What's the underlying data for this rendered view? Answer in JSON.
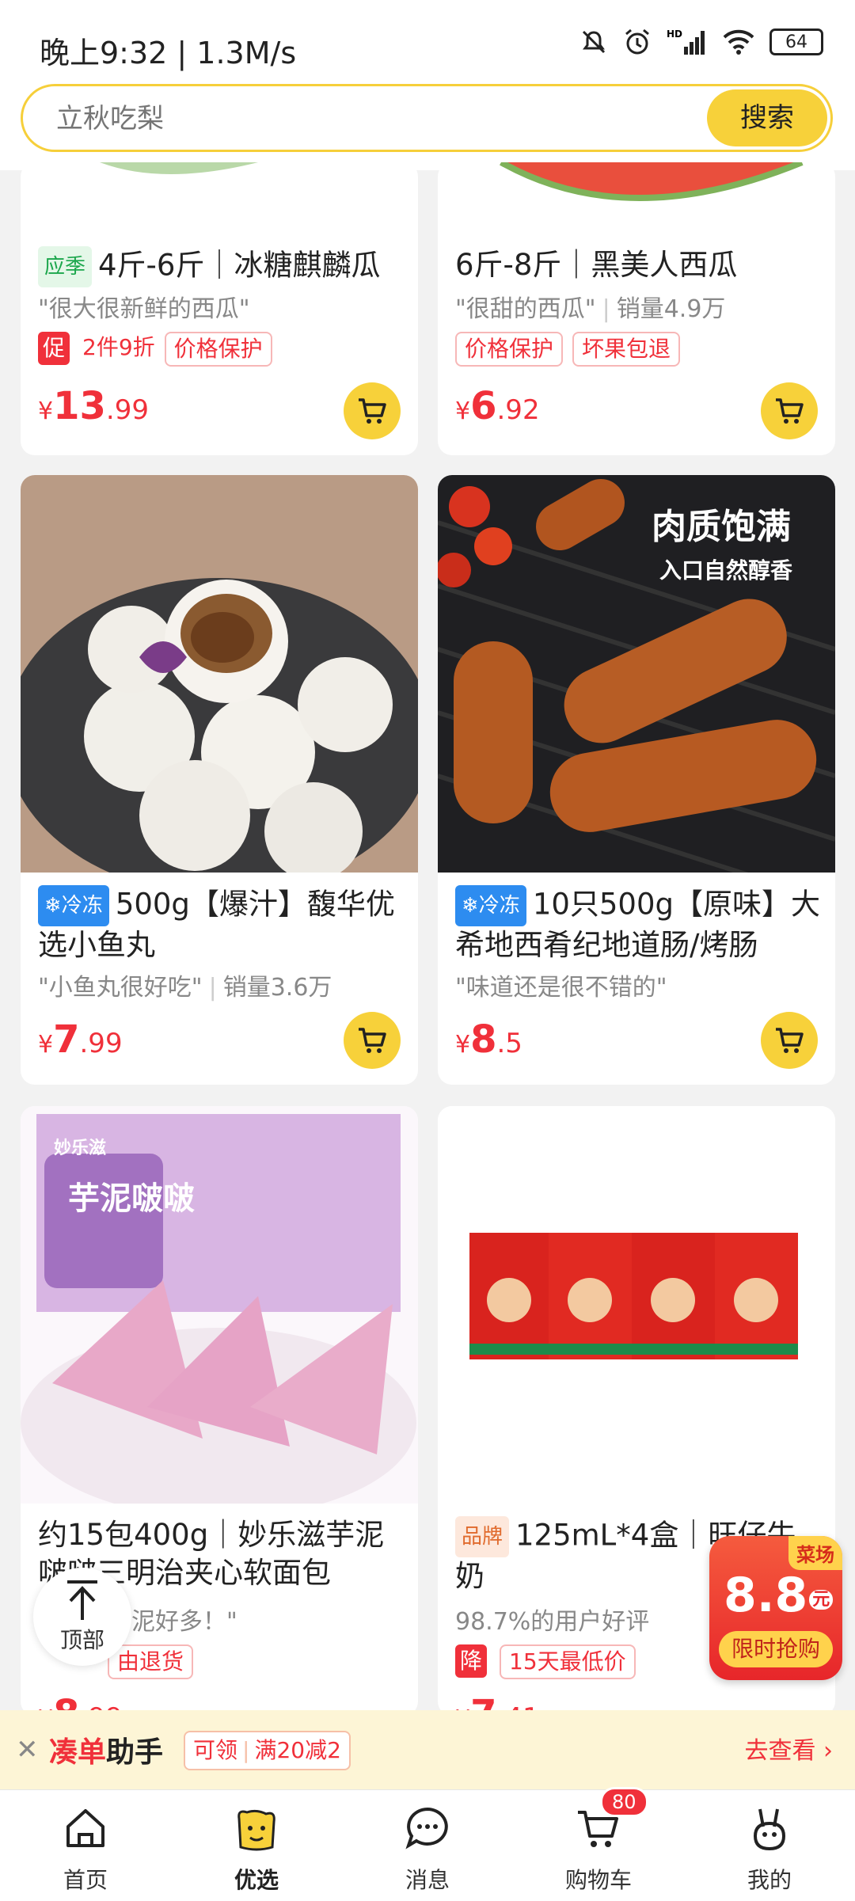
{
  "status_bar": {
    "time": "晚上9:32 | 1.3M/s",
    "battery": "64",
    "icons": [
      "bell-off-icon",
      "alarm-icon",
      "signal-icon",
      "wifi-icon",
      "battery-icon"
    ]
  },
  "search": {
    "placeholder": "立秋吃梨",
    "button": "搜索"
  },
  "products": [
    {
      "tag": "应季",
      "title": "4斤-6斤｜冰糖麒麟瓜",
      "quote": "\"很大很新鲜的西瓜\"",
      "sales": "",
      "promo_badge": "促",
      "promos": [
        "2件9折",
        "价格保护"
      ],
      "price_int": "13",
      "price_dec": ".99",
      "yen": "¥"
    },
    {
      "tag": "",
      "title": "6斤-8斤｜黑美人西瓜",
      "quote": "\"很甜的西瓜\"",
      "sales": "销量4.9万",
      "promo_badge": "",
      "promos": [
        "价格保护",
        "坏果包退"
      ],
      "price_int": "6",
      "price_dec": ".92",
      "yen": "¥"
    },
    {
      "tag": "冷冻",
      "title": "500g【爆汁】馥华优选小鱼丸",
      "quote": "\"小鱼丸很好吃\"",
      "sales": "销量3.6万",
      "price_int": "7",
      "price_dec": ".99",
      "yen": "¥"
    },
    {
      "tag": "冷冻",
      "title": "10只500g【原味】大希地西肴纪地道肠/烤肠",
      "quote": "\"味道还是很不错的\"",
      "sales": "",
      "price_int": "8",
      "price_dec": ".5",
      "yen": "¥",
      "image_text_1": "肉质饱满",
      "image_text_2": "入口自然醇香"
    },
    {
      "title": "约15包400g｜妙乐滋芋泥啵啵三明治夹心软面包",
      "quote": "芋泥好多！\"",
      "promo": "由退货",
      "price_int": "8",
      "price_dec": ".99",
      "image_text_1": "妙乐滋",
      "image_text_2": "芋泥啵啵"
    },
    {
      "tag": "品牌",
      "title": "125mL*4盒｜旺仔牛奶",
      "quote": "98.7%的用户好评",
      "promo_badge": "降",
      "promos": [
        "15天最低价"
      ],
      "price_int": "7",
      "price_dec": ".41"
    }
  ],
  "to_top": {
    "label": "顶部"
  },
  "flash_sale": {
    "corner": "菜场",
    "price": "8.8",
    "unit": "元",
    "label": "限时抢购"
  },
  "helper": {
    "logo_a": "凑单",
    "logo_b": "助手",
    "chip_a": "可领",
    "chip_b": "满20减2",
    "go": "去查看"
  },
  "tabbar": {
    "items": [
      {
        "label": "首页"
      },
      {
        "label": "优选"
      },
      {
        "label": "消息"
      },
      {
        "label": "购物车",
        "badge": "80"
      },
      {
        "label": "我的"
      }
    ]
  },
  "colors": {
    "accent": "#f7d13a",
    "price_red": "#f0303a",
    "frozen_blue": "#2d8cf0",
    "seasonal_green": "#1aa64b"
  }
}
